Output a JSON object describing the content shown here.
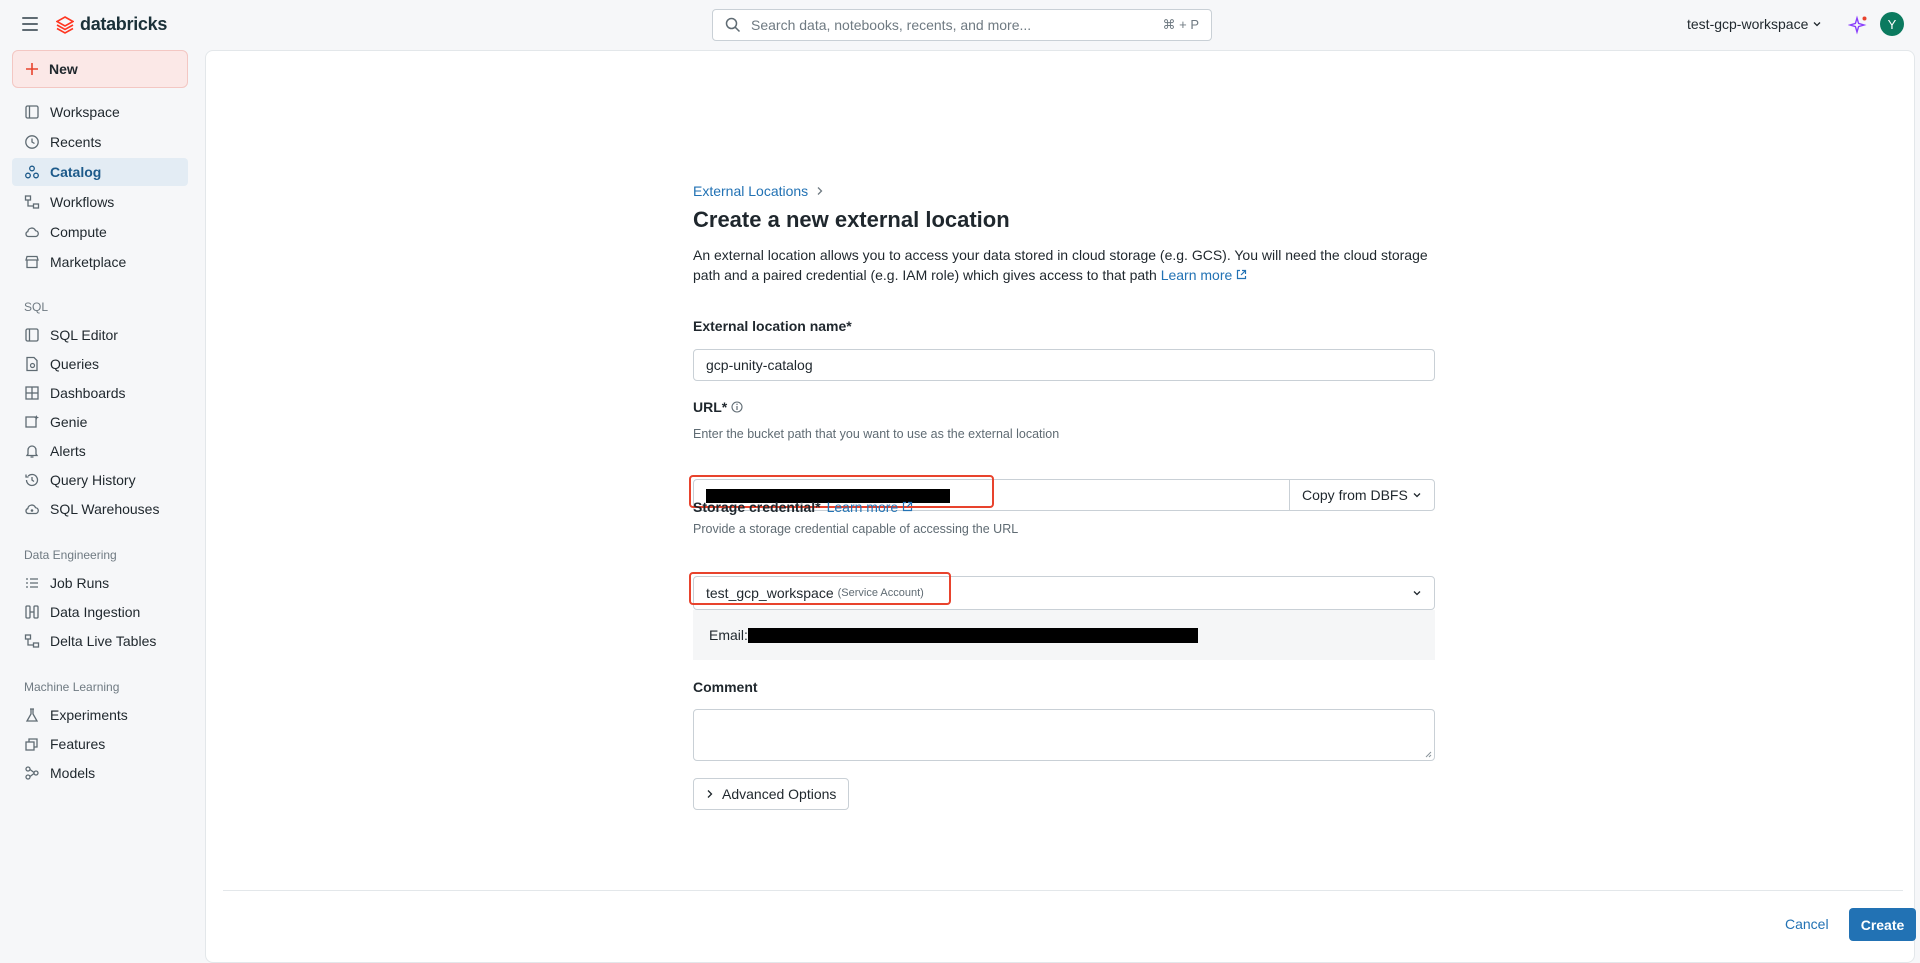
{
  "header": {
    "brand": "databricks",
    "search_placeholder": "Search data, notebooks, recents, and more...",
    "search_shortcut": "⌘ + P",
    "workspace": "test-gcp-workspace",
    "avatar_initial": "Y"
  },
  "sidebar": {
    "new_label": "New",
    "items": [
      {
        "label": "Workspace",
        "icon": "folder-icon"
      },
      {
        "label": "Recents",
        "icon": "clock-icon"
      },
      {
        "label": "Catalog",
        "icon": "catalog-icon",
        "active": true
      },
      {
        "label": "Workflows",
        "icon": "workflows-icon"
      },
      {
        "label": "Compute",
        "icon": "cloud-icon"
      },
      {
        "label": "Marketplace",
        "icon": "store-icon"
      }
    ],
    "sql_section": "SQL",
    "sql_items": [
      {
        "label": "SQL Editor"
      },
      {
        "label": "Queries"
      },
      {
        "label": "Dashboards"
      },
      {
        "label": "Genie"
      },
      {
        "label": "Alerts"
      },
      {
        "label": "Query History"
      },
      {
        "label": "SQL Warehouses"
      }
    ],
    "de_section": "Data Engineering",
    "de_items": [
      {
        "label": "Job Runs"
      },
      {
        "label": "Data Ingestion"
      },
      {
        "label": "Delta Live Tables"
      }
    ],
    "ml_section": "Machine Learning",
    "ml_items": [
      {
        "label": "Experiments"
      },
      {
        "label": "Features"
      },
      {
        "label": "Models"
      }
    ]
  },
  "form": {
    "breadcrumb": "External Locations",
    "title": "Create a new external location",
    "description": "An external location allows you to access your data stored in cloud storage (e.g. GCS). You will need the cloud storage path and a paired credential (e.g. IAM role) which gives access to that path",
    "learn_more": "Learn more",
    "name_label": "External location name*",
    "name_value": "gcp-unity-catalog",
    "url_label": "URL*",
    "url_hint": "Enter the bucket path that you want to use as the external location",
    "copy_from": "Copy from DBFS",
    "credential_label": "Storage credential*",
    "credential_learn_more": "Learn more",
    "credential_hint": "Provide a storage credential capable of accessing the URL",
    "credential_value": "test_gcp_workspace",
    "credential_type": "(Service Account)",
    "email_label": "Email:",
    "comment_label": "Comment",
    "advanced": "Advanced Options",
    "cancel": "Cancel",
    "create": "Create"
  },
  "colors": {
    "accent": "#2272b4",
    "highlight": "#e8432d",
    "brand": "#ff3621"
  }
}
